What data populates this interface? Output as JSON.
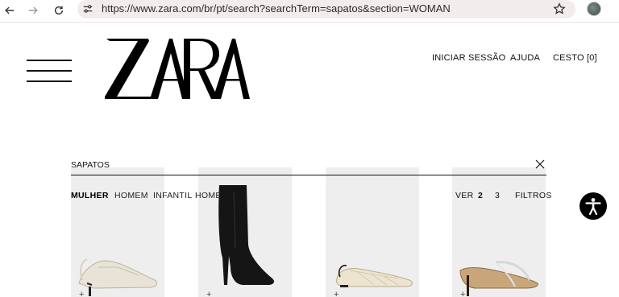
{
  "browser": {
    "url": "https://www.zara.com/br/pt/search?searchTerm=sapatos&section=WOMAN",
    "icons": [
      "back-arrow-icon",
      "forward-arrow-icon",
      "reload-icon",
      "site-settings-icon",
      "bookmark-star-icon",
      "profile-avatar"
    ]
  },
  "header": {
    "logo": "ZARA",
    "links": {
      "login": "INICIAR SESSÃO",
      "help": "AJUDA",
      "cart": "CESTO [0]"
    }
  },
  "search": {
    "value": "SAPATOS"
  },
  "tabs": [
    {
      "label": "MULHER",
      "active": true
    },
    {
      "label": "HOMEM",
      "active": false
    },
    {
      "label": "INFANTIL",
      "active": false
    },
    {
      "label": "HOME",
      "active": false
    }
  ],
  "view": {
    "label": "VER",
    "options": [
      "2",
      "3"
    ],
    "selected": "2",
    "filters": "FILTROS"
  },
  "products": [
    {
      "type": "slingback-mesh-heel",
      "add": "+"
    },
    {
      "type": "black-knee-boot",
      "add": "+"
    },
    {
      "type": "woven-slingback-flat",
      "add": "+"
    },
    {
      "type": "vinyl-mule-heel",
      "add": "+"
    }
  ],
  "colors": {
    "card_bg": "#efeeee",
    "text": "#111111",
    "url_bar": "#f3ecec"
  }
}
